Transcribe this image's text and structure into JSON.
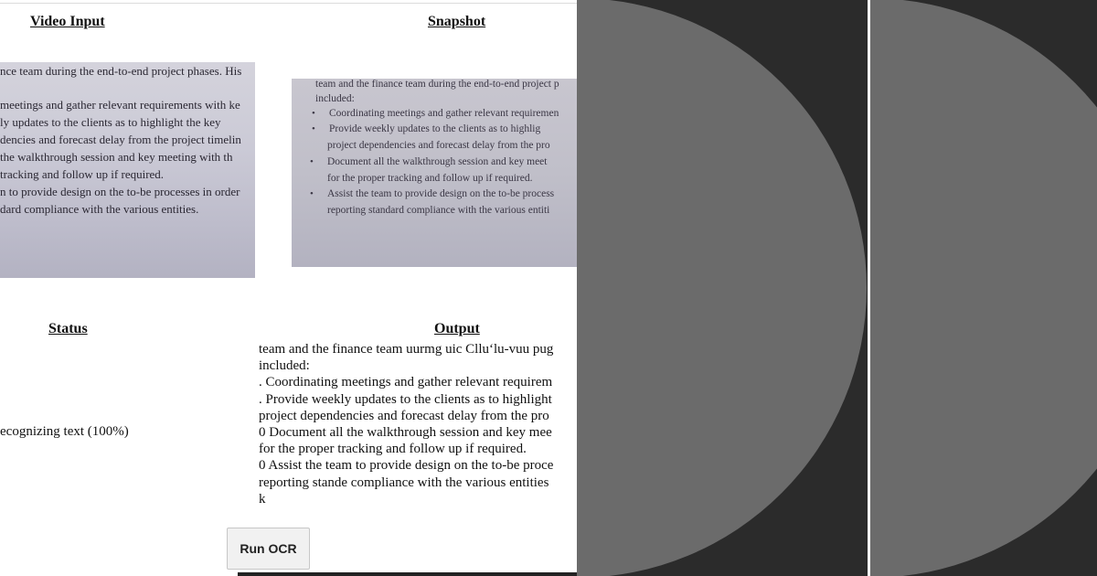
{
  "headings": {
    "video_input": "Video Input",
    "snapshot": "Snapshot",
    "status": "Status",
    "output": "Output"
  },
  "video_feed_lines": [
    "nce team during the end-to-end project phases. His",
    "meetings and gather relevant requirements with ke",
    "ly updates to the clients as to highlight the key",
    "dencies and forecast delay from the project timelin",
    "the walkthrough session and key meeting with th",
    "tracking and follow up if required.",
    "n to provide design on the to-be processes in order",
    "dard compliance with the various entities."
  ],
  "snapshot_lines": [
    "team and the finance team during the end-to-end project p",
    "included:",
    "Coordinating meetings and gather relevant requiremen",
    "Provide weekly updates to the clients as to highlig",
    "project dependencies and forecast delay from the pro",
    "Document all the walkthrough session and key meet",
    "for the proper tracking and follow up if required.",
    "Assist the team to provide design on the to-be process",
    "reporting standard compliance with the various entiti"
  ],
  "status_text": "ecognizing text (100%)",
  "output_lines": [
    "team and the finance team uurmg uic Cllu‘lu-vuu pug",
    "included:",
    ". Coordinating meetings and gather relevant requirem",
    ". Provide weekly updates to the clients as to highlight",
    "project dependencies and forecast delay from the pro",
    "0 Document all the walkthrough session and key mee",
    "for the proper tracking and follow up if required.",
    "0 Assist the team to provide design on the to-be proce",
    "reporting stande compliance with the various entities",
    "k"
  ],
  "run_button_label": "Run OCR",
  "colors": {
    "panel_background": "#2b2b2b",
    "panel_circle": "#6b6b6b",
    "button_background": "#f1f1f1"
  }
}
